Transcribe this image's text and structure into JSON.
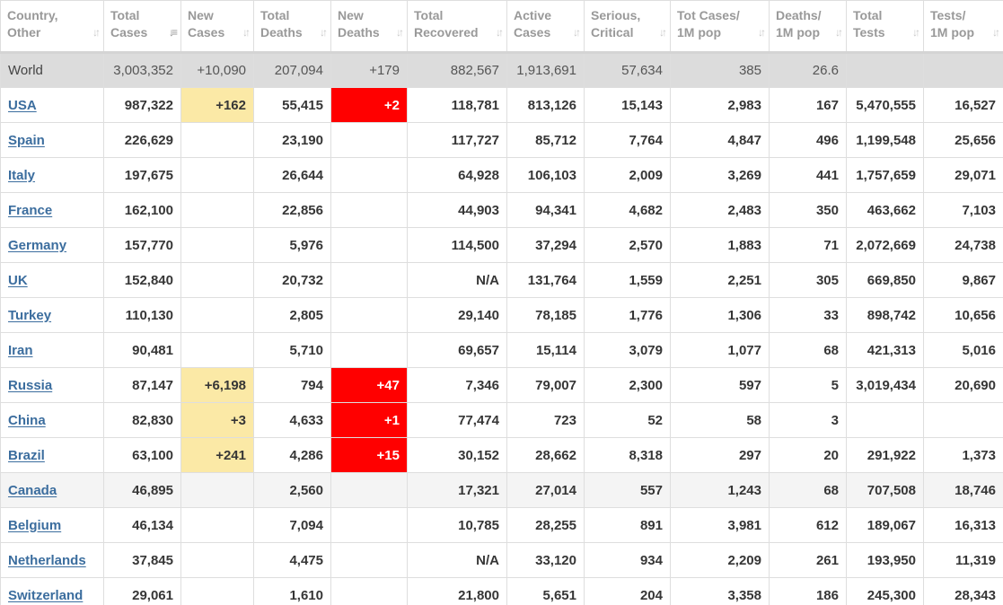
{
  "columns": [
    {
      "line1": "Country,",
      "line2": "Other",
      "sort_icon": "sort-updown-icon"
    },
    {
      "line1": "Total",
      "line2": "Cases",
      "sort_icon": "sort-desc-icon",
      "active": true
    },
    {
      "line1": "New",
      "line2": "Cases",
      "sort_icon": "sort-updown-icon"
    },
    {
      "line1": "Total",
      "line2": "Deaths",
      "sort_icon": "sort-updown-icon"
    },
    {
      "line1": "New",
      "line2": "Deaths",
      "sort_icon": "sort-updown-icon"
    },
    {
      "line1": "Total",
      "line2": "Recovered",
      "sort_icon": "sort-updown-icon"
    },
    {
      "line1": "Active",
      "line2": "Cases",
      "sort_icon": "sort-updown-icon"
    },
    {
      "line1": "Serious,",
      "line2": "Critical",
      "sort_icon": "sort-updown-icon"
    },
    {
      "line1": "Tot Cases/",
      "line2": "1M pop",
      "sort_icon": "sort-updown-icon"
    },
    {
      "line1": "Deaths/",
      "line2": "1M pop",
      "sort_icon": "sort-updown-icon"
    },
    {
      "line1": "Total",
      "line2": "Tests",
      "sort_icon": "sort-updown-icon"
    },
    {
      "line1": "Tests/",
      "line2": "1M pop",
      "sort_icon": "sort-updown-icon"
    }
  ],
  "world": [
    "World",
    "3,003,352",
    "+10,090",
    "207,094",
    "+179",
    "882,567",
    "1,913,691",
    "57,634",
    "385",
    "26.6",
    "",
    ""
  ],
  "rows": [
    [
      "USA",
      "987,322",
      "+162",
      "55,415",
      "+2",
      "118,781",
      "813,126",
      "15,143",
      "2,983",
      "167",
      "5,470,555",
      "16,527"
    ],
    [
      "Spain",
      "226,629",
      "",
      "23,190",
      "",
      "117,727",
      "85,712",
      "7,764",
      "4,847",
      "496",
      "1,199,548",
      "25,656"
    ],
    [
      "Italy",
      "197,675",
      "",
      "26,644",
      "",
      "64,928",
      "106,103",
      "2,009",
      "3,269",
      "441",
      "1,757,659",
      "29,071"
    ],
    [
      "France",
      "162,100",
      "",
      "22,856",
      "",
      "44,903",
      "94,341",
      "4,682",
      "2,483",
      "350",
      "463,662",
      "7,103"
    ],
    [
      "Germany",
      "157,770",
      "",
      "5,976",
      "",
      "114,500",
      "37,294",
      "2,570",
      "1,883",
      "71",
      "2,072,669",
      "24,738"
    ],
    [
      "UK",
      "152,840",
      "",
      "20,732",
      "",
      "N/A",
      "131,764",
      "1,559",
      "2,251",
      "305",
      "669,850",
      "9,867"
    ],
    [
      "Turkey",
      "110,130",
      "",
      "2,805",
      "",
      "29,140",
      "78,185",
      "1,776",
      "1,306",
      "33",
      "898,742",
      "10,656"
    ],
    [
      "Iran",
      "90,481",
      "",
      "5,710",
      "",
      "69,657",
      "15,114",
      "3,079",
      "1,077",
      "68",
      "421,313",
      "5,016"
    ],
    [
      "Russia",
      "87,147",
      "+6,198",
      "794",
      "+47",
      "7,346",
      "79,007",
      "2,300",
      "597",
      "5",
      "3,019,434",
      "20,690"
    ],
    [
      "China",
      "82,830",
      "+3",
      "4,633",
      "+1",
      "77,474",
      "723",
      "52",
      "58",
      "3",
      "",
      ""
    ],
    [
      "Brazil",
      "63,100",
      "+241",
      "4,286",
      "+15",
      "30,152",
      "28,662",
      "8,318",
      "297",
      "20",
      "291,922",
      "1,373"
    ],
    [
      "Canada",
      "46,895",
      "",
      "2,560",
      "",
      "17,321",
      "27,014",
      "557",
      "1,243",
      "68",
      "707,508",
      "18,746"
    ],
    [
      "Belgium",
      "46,134",
      "",
      "7,094",
      "",
      "10,785",
      "28,255",
      "891",
      "3,981",
      "612",
      "189,067",
      "16,313"
    ],
    [
      "Netherlands",
      "37,845",
      "",
      "4,475",
      "",
      "N/A",
      "33,120",
      "934",
      "2,209",
      "261",
      "193,950",
      "11,319"
    ],
    [
      "Switzerland",
      "29,061",
      "",
      "1,610",
      "",
      "21,800",
      "5,651",
      "204",
      "3,358",
      "186",
      "245,300",
      "28,343"
    ]
  ],
  "alt_rows": [
    11
  ],
  "colors": {
    "link": "#3b6d9e",
    "new_cases_highlight": "#fbe9a6",
    "new_deaths_highlight": "#ff0000",
    "world_row_bg": "#dcdcdc",
    "header_text": "#999999"
  }
}
